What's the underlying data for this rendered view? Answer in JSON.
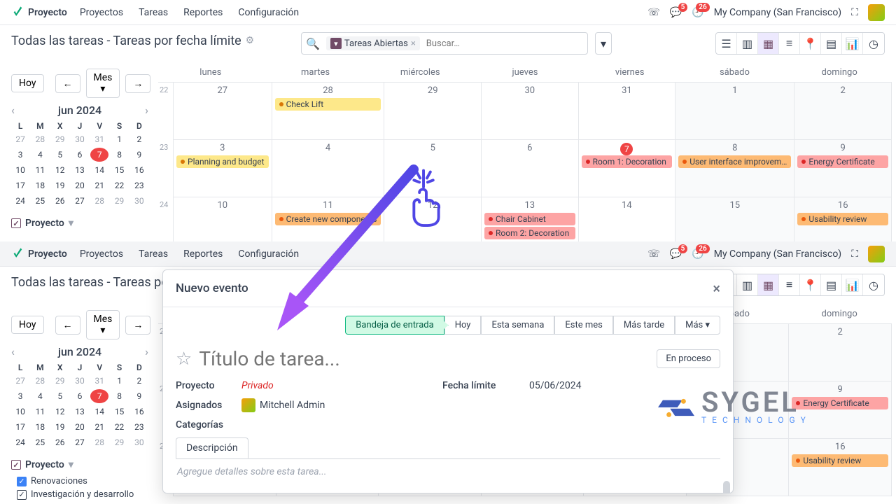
{
  "nav": {
    "brand": "Proyecto",
    "links": [
      "Proyectos",
      "Tareas",
      "Reportes",
      "Configuración"
    ],
    "msg_count": "5",
    "act_count": "26",
    "company": "My Company (San Francisco)"
  },
  "breadcrumb": "Todas las tareas - Tareas por fecha límite",
  "search": {
    "chip": "Tareas Abiertas",
    "placeholder": "Buscar…"
  },
  "cal_toolbar": {
    "today": "Hoy",
    "range": "Mes"
  },
  "mini_cal": {
    "title": "jun 2024",
    "dow": [
      "L",
      "M",
      "X",
      "J",
      "V",
      "S",
      "D"
    ],
    "rows": [
      [
        "27",
        "28",
        "29",
        "30",
        "31",
        "1",
        "2"
      ],
      [
        "3",
        "4",
        "5",
        "6",
        "7",
        "8",
        "9"
      ],
      [
        "10",
        "11",
        "12",
        "13",
        "14",
        "15",
        "16"
      ],
      [
        "17",
        "18",
        "19",
        "20",
        "21",
        "22",
        "23"
      ],
      [
        "24",
        "25",
        "26",
        "27",
        "28",
        "29",
        "30"
      ]
    ],
    "today": "7"
  },
  "filters": {
    "root": "Proyecto",
    "sub": [
      "Renovaciones",
      "Investigación y desarrollo"
    ]
  },
  "big_cal": {
    "dow": [
      "lunes",
      "martes",
      "miércoles",
      "jueves",
      "viernes",
      "sábado",
      "domingo"
    ],
    "weeks": [
      "22",
      "23",
      "24"
    ],
    "row1": [
      "27",
      "28",
      "29",
      "30",
      "31",
      "1",
      "2"
    ],
    "row2": [
      "3",
      "4",
      "5",
      "6",
      "7",
      "8",
      "9"
    ],
    "row3": [
      "10",
      "11",
      "12",
      "13",
      "14",
      "15",
      "16"
    ],
    "events": {
      "check_lift": "Check Lift",
      "planning": "Planning and budget",
      "room1": "Room 1: Decoration",
      "ui": "User interface improvem…",
      "energy": "Energy Certificate",
      "components": "Create new components",
      "chair": "Chair Cabinet",
      "room2": "Room 2: Decoration",
      "usability": "Usability review"
    }
  },
  "modal": {
    "title": "Nuevo evento",
    "pills": [
      "Bandeja de entrada",
      "Hoy",
      "Esta semana",
      "Este mes",
      "Más tarde",
      "Más"
    ],
    "task_placeholder": "Título de tarea...",
    "status": "En proceso",
    "lbl_project": "Proyecto",
    "val_project": "Privado",
    "lbl_deadline": "Fecha límite",
    "val_deadline": "05/06/2024",
    "lbl_assignees": "Asignados",
    "val_assignee": "Mitchell Admin",
    "lbl_categories": "Categorías",
    "tab_desc": "Descripción",
    "desc_placeholder": "Agregue detalles sobre esta tarea..."
  },
  "watermark": {
    "name": "SYGEL",
    "sub": "TECHNOLOGY"
  }
}
